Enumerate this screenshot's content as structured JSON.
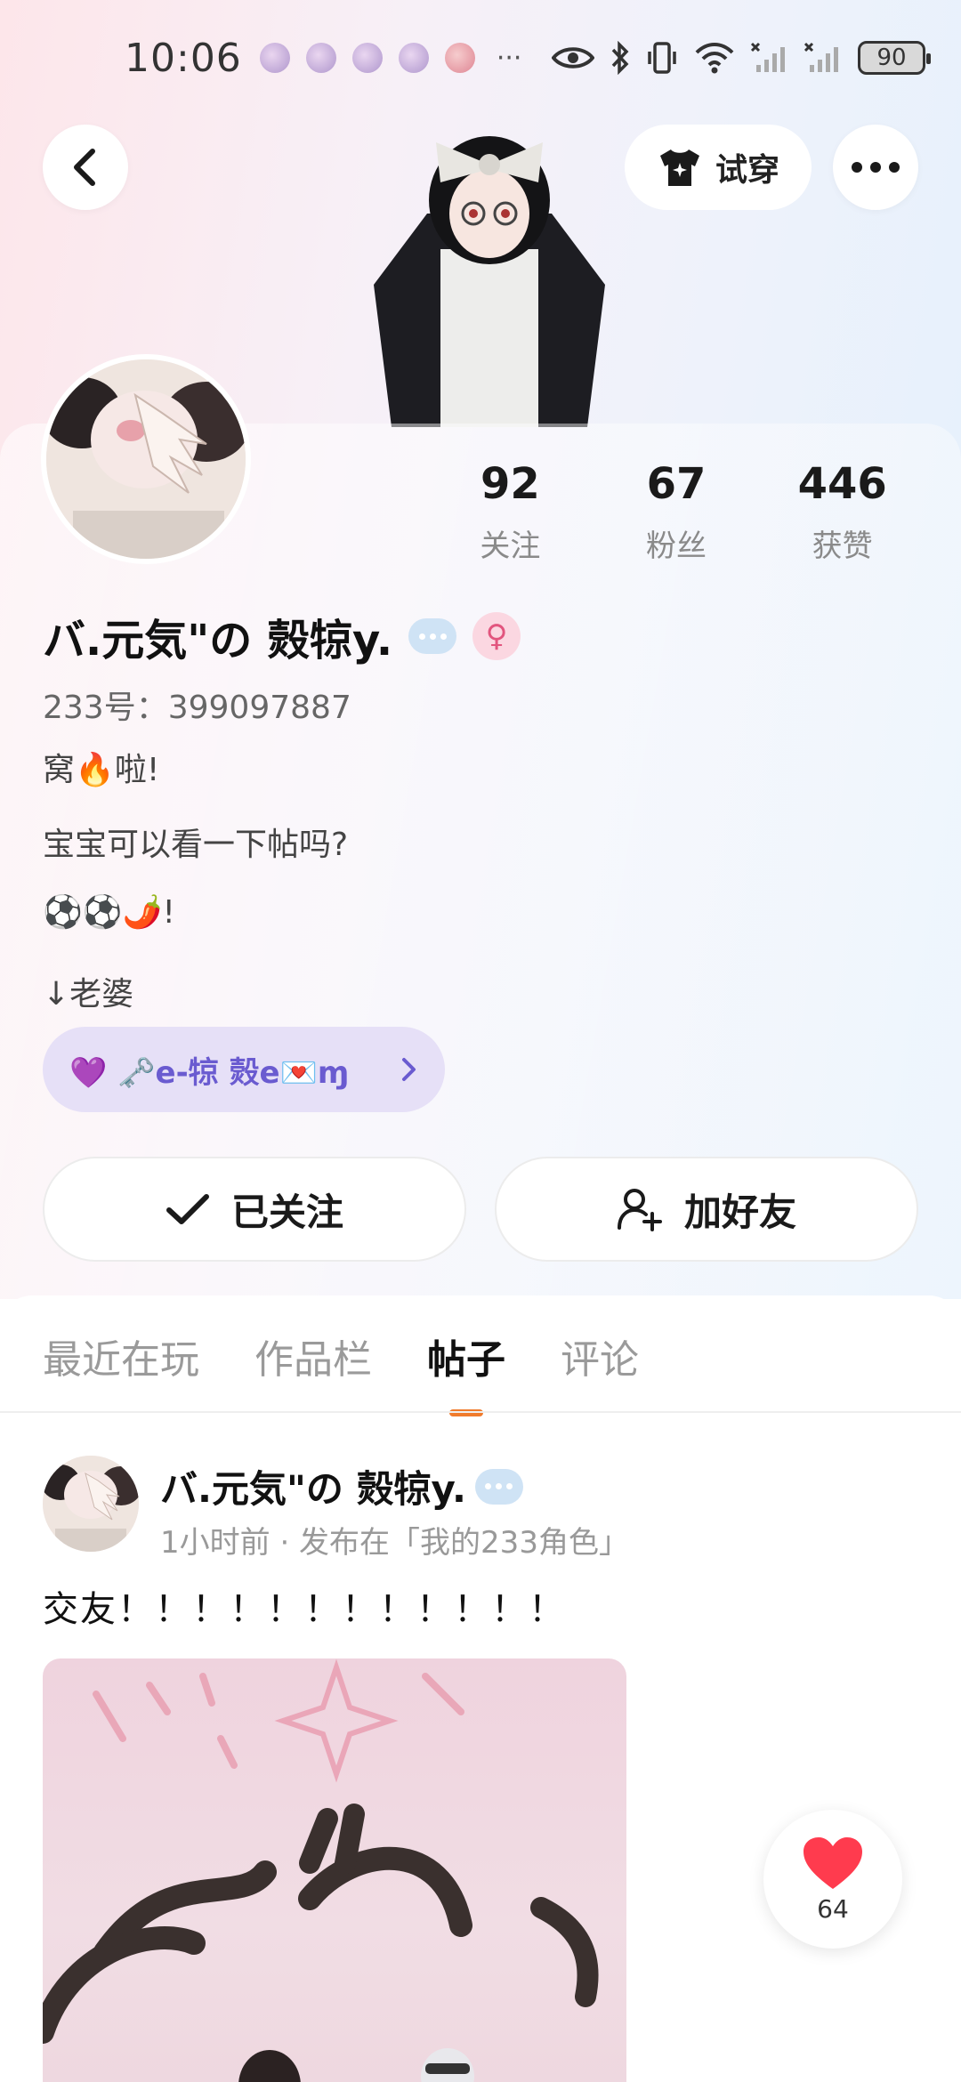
{
  "status_bar": {
    "time": "10:06",
    "more": "···",
    "battery": "90"
  },
  "header": {
    "try_on_label": "试穿"
  },
  "profile": {
    "stats": [
      {
        "value": "92",
        "label": "关注"
      },
      {
        "value": "67",
        "label": "粉丝"
      },
      {
        "value": "446",
        "label": "获赞"
      }
    ],
    "nickname": "バ.元気\"の 㷤㹁y.",
    "gender_symbol": "♀",
    "id_line": "233号：399097887",
    "bio": [
      "窝🔥啦!",
      "宝宝可以看一下帖吗?",
      "⚽⚽🌶️!",
      "↓老婆"
    ],
    "tag_pill": "💜 🗝️e-㹁 㷤e💌ɱ",
    "follow_label": "已关注",
    "add_friend_label": "加好友"
  },
  "tabs": [
    {
      "label": "最近在玩",
      "active": false
    },
    {
      "label": "作品栏",
      "active": false
    },
    {
      "label": "帖子",
      "active": true
    },
    {
      "label": "评论",
      "active": false
    }
  ],
  "post": {
    "author": "バ.元気\"の 㷤㹁y.",
    "meta": "1小时前 · 发布在「我的233角色」",
    "text": "交友！！！！！！！！！！！！",
    "like_count": "64"
  },
  "colors": {
    "accent_orange": "#f07b2c",
    "tag_purple": "#6a5bd0",
    "like_red": "#ff3b4e"
  },
  "icons": {
    "back": "chevron-left-icon",
    "try_on": "tshirt-icon",
    "menu": "more-horizontal-icon",
    "follow_check": "check-icon",
    "add_friend": "add-user-icon",
    "like": "heart-icon"
  }
}
